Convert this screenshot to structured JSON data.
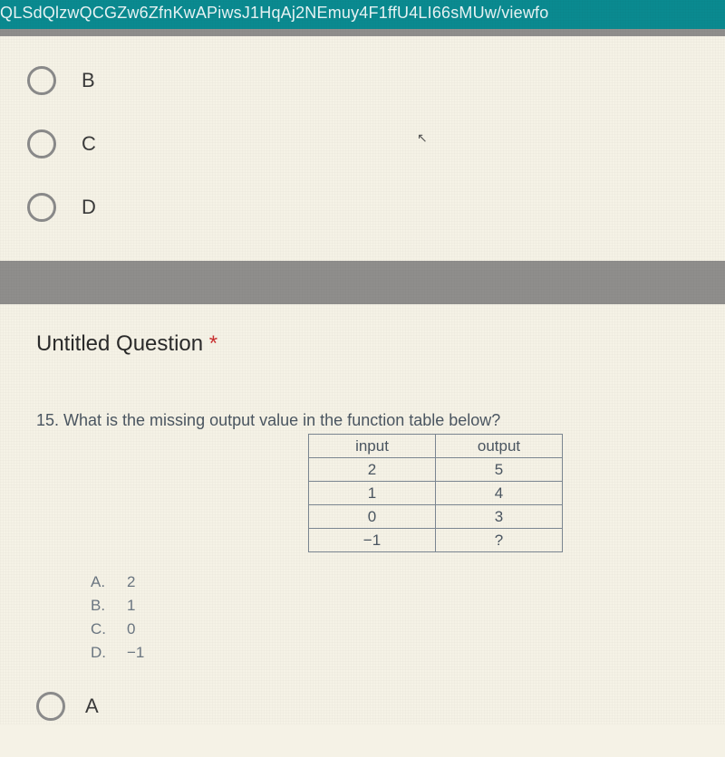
{
  "url_bar": "QLSdQlzwQCGZw6ZfnKwAPiwsJ1HqAj2NEmuy4F1ffU4LI66sMUw/viewfo",
  "top_options": {
    "b": "B",
    "c": "C",
    "d": "D"
  },
  "question": {
    "title": "Untitled Question",
    "asterisk": "*",
    "number_and_text": "15. What is the missing output value in the function table below?",
    "table": {
      "head_input": "input",
      "head_output": "output",
      "rows": [
        {
          "input": "2",
          "output": "5"
        },
        {
          "input": "1",
          "output": "4"
        },
        {
          "input": "0",
          "output": "3"
        },
        {
          "input": "−1",
          "output": "?"
        }
      ]
    },
    "answers": [
      {
        "letter": "A.",
        "value": "2"
      },
      {
        "letter": "B.",
        "value": "1"
      },
      {
        "letter": "C.",
        "value": "0"
      },
      {
        "letter": "D.",
        "value": "−1"
      }
    ],
    "bottom_option": "A"
  },
  "chart_data": {
    "type": "table",
    "title": "Function table",
    "columns": [
      "input",
      "output"
    ],
    "rows": [
      [
        2,
        5
      ],
      [
        1,
        4
      ],
      [
        0,
        3
      ],
      [
        -1,
        null
      ]
    ]
  }
}
